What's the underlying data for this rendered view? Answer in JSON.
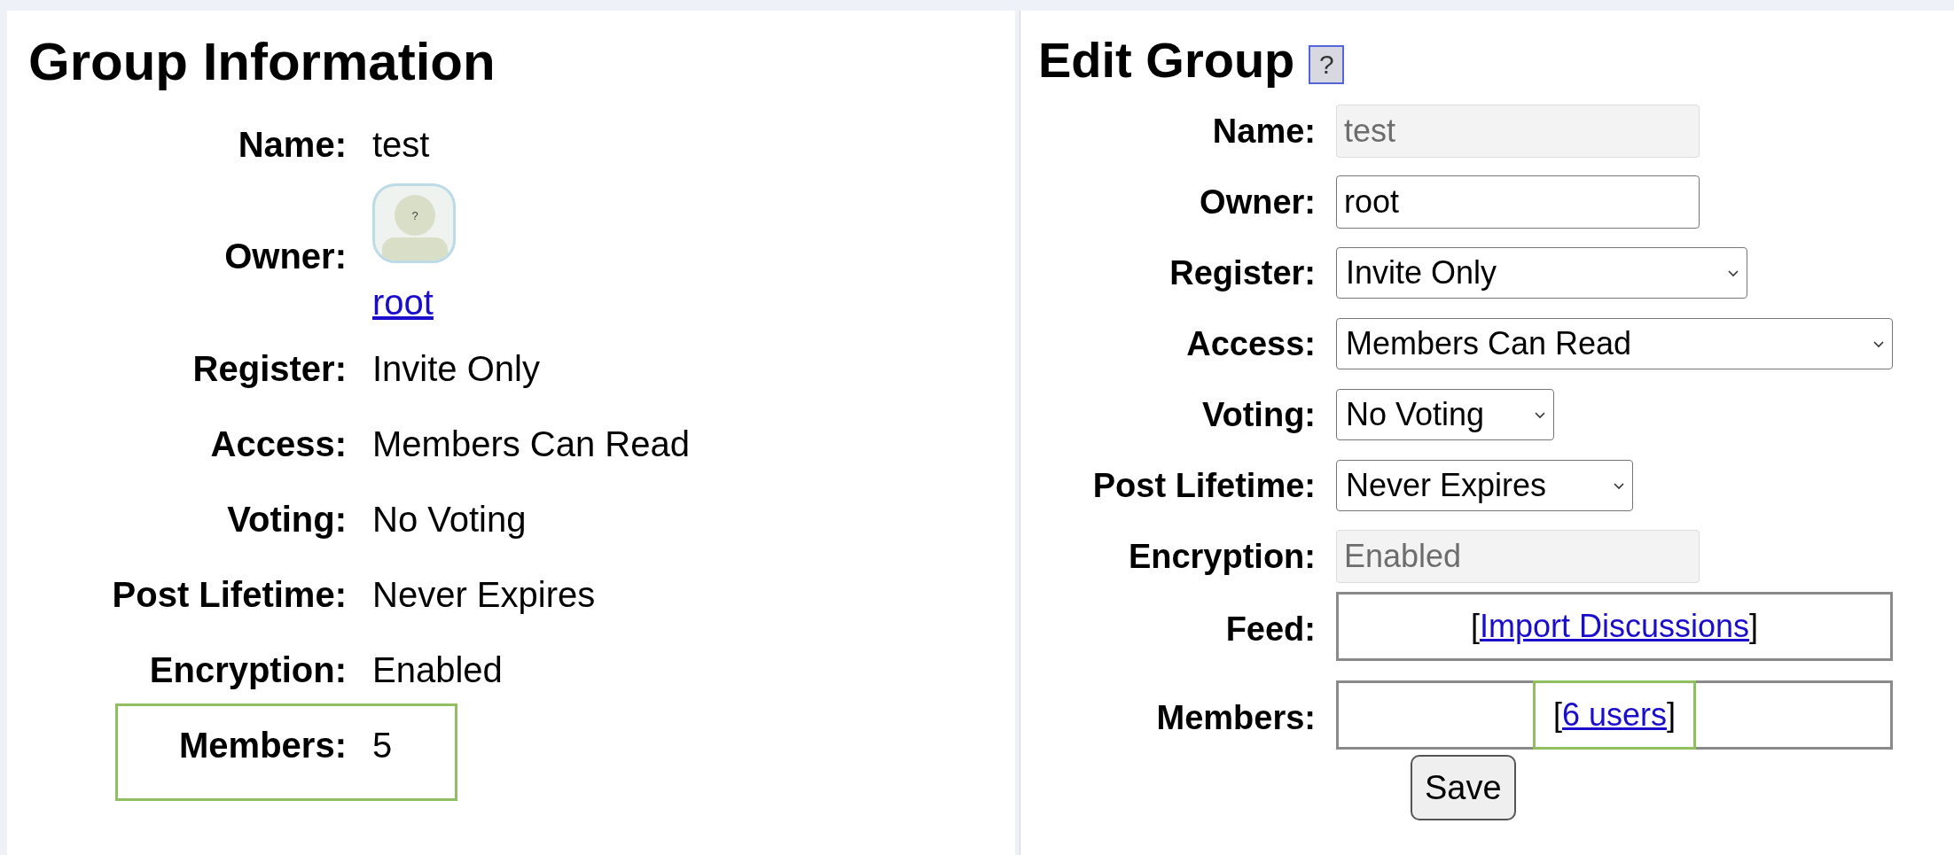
{
  "group_info": {
    "title": "Group Information",
    "fields": [
      {
        "kind": "text",
        "label": "Name:",
        "value": "test",
        "highlighted": false
      },
      {
        "kind": "owner",
        "label": "Owner:",
        "value": "root",
        "avatar_mark": "?",
        "highlighted": false
      },
      {
        "kind": "text",
        "label": "Register:",
        "value": "Invite Only",
        "highlighted": false
      },
      {
        "kind": "text",
        "label": "Access:",
        "value": "Members Can Read",
        "highlighted": false
      },
      {
        "kind": "text",
        "label": "Voting:",
        "value": "No Voting",
        "highlighted": false
      },
      {
        "kind": "text",
        "label": "Post Lifetime:",
        "value": "Never Expires",
        "highlighted": false
      },
      {
        "kind": "text",
        "label": "Encryption:",
        "value": "Enabled",
        "highlighted": false
      },
      {
        "kind": "text",
        "label": "Members:",
        "value": "5",
        "highlighted": true
      }
    ]
  },
  "edit_group": {
    "title": "Edit Group",
    "help_button": "?",
    "fields": [
      {
        "kind": "input",
        "label": "Name:",
        "value": "test",
        "disabled": true
      },
      {
        "kind": "input",
        "label": "Owner:",
        "value": "root",
        "disabled": false
      },
      {
        "kind": "select",
        "label": "Register:",
        "value": "Invite Only"
      },
      {
        "kind": "select",
        "label": "Access:",
        "value": "Members Can Read"
      },
      {
        "kind": "select",
        "label": "Voting:",
        "value": "No Voting"
      },
      {
        "kind": "select",
        "label": "Post Lifetime:",
        "value": "Never Expires"
      },
      {
        "kind": "input",
        "label": "Encryption:",
        "value": "Enabled",
        "disabled": true
      },
      {
        "kind": "link_box",
        "label": "Feed:",
        "prefix": "[",
        "link": "Import Discussions",
        "suffix": "]",
        "highlighted": false
      },
      {
        "kind": "link_box",
        "label": "Members:",
        "prefix": "[",
        "link": "6 users",
        "suffix": "]",
        "highlighted": true
      }
    ],
    "save_button": "Save"
  }
}
